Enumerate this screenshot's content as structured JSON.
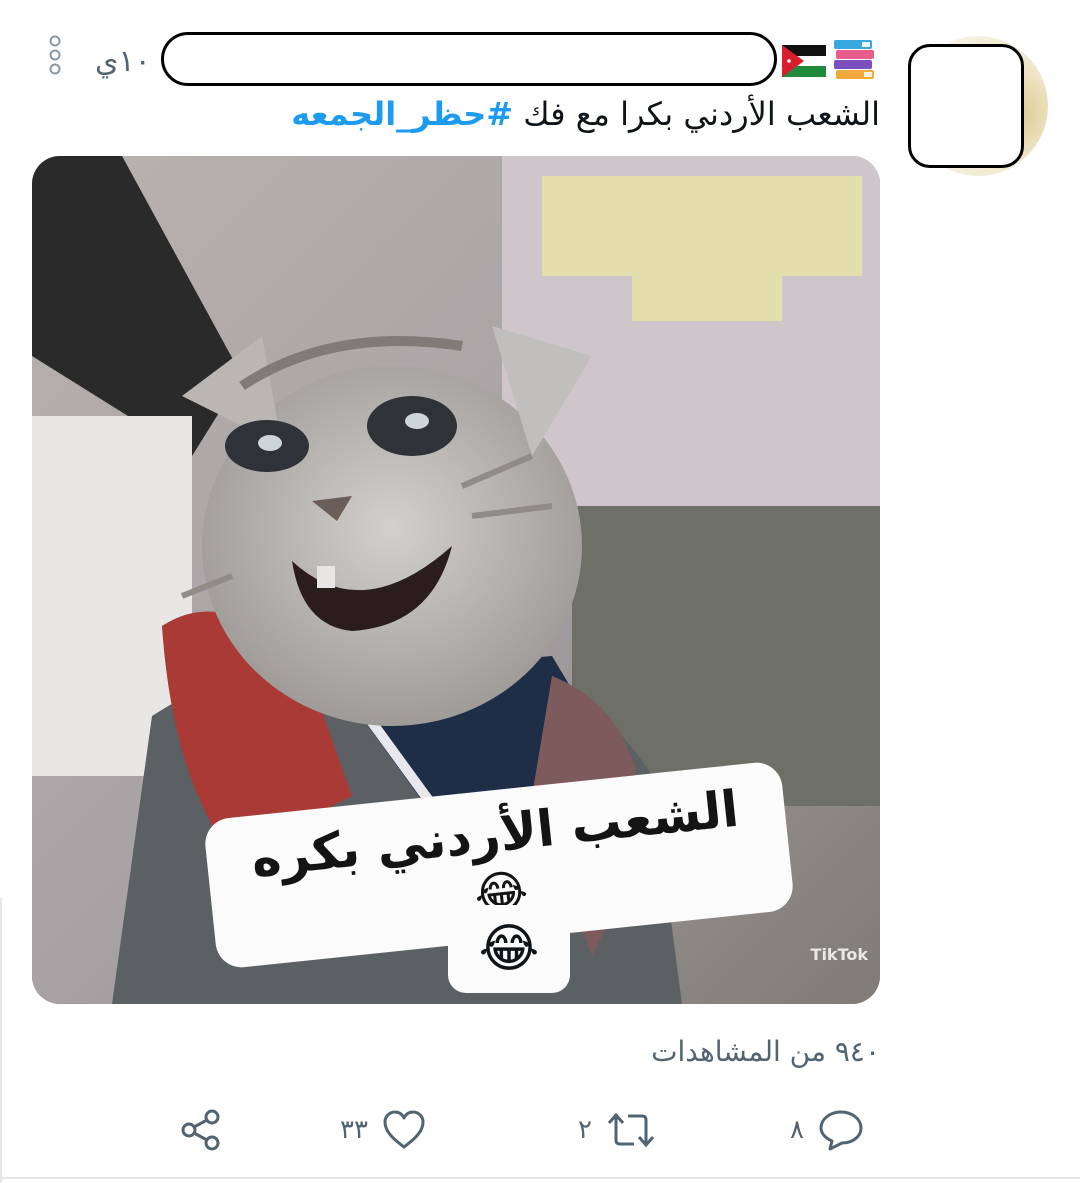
{
  "tweet": {
    "time": "١٠ي",
    "text_plain": "الشعب الأردني بكرا مع فك",
    "hashtag": "#حظر_الجمعه",
    "views": "٩٤٠ من المشاهدات"
  },
  "media": {
    "caption": "الشعب الأردني بكره",
    "caption_emoji": "😂",
    "watermark": "TikTok"
  },
  "actions": {
    "reply_count": "٨",
    "retweet_count": "٢",
    "like_count": "٣٣"
  },
  "icons": {
    "more": "more-vertical-icon",
    "reply": "reply-icon",
    "retweet": "retweet-icon",
    "like": "heart-icon",
    "share": "share-icon"
  },
  "colors": {
    "hashtag": "#1d9bf0",
    "muted": "#536471"
  }
}
